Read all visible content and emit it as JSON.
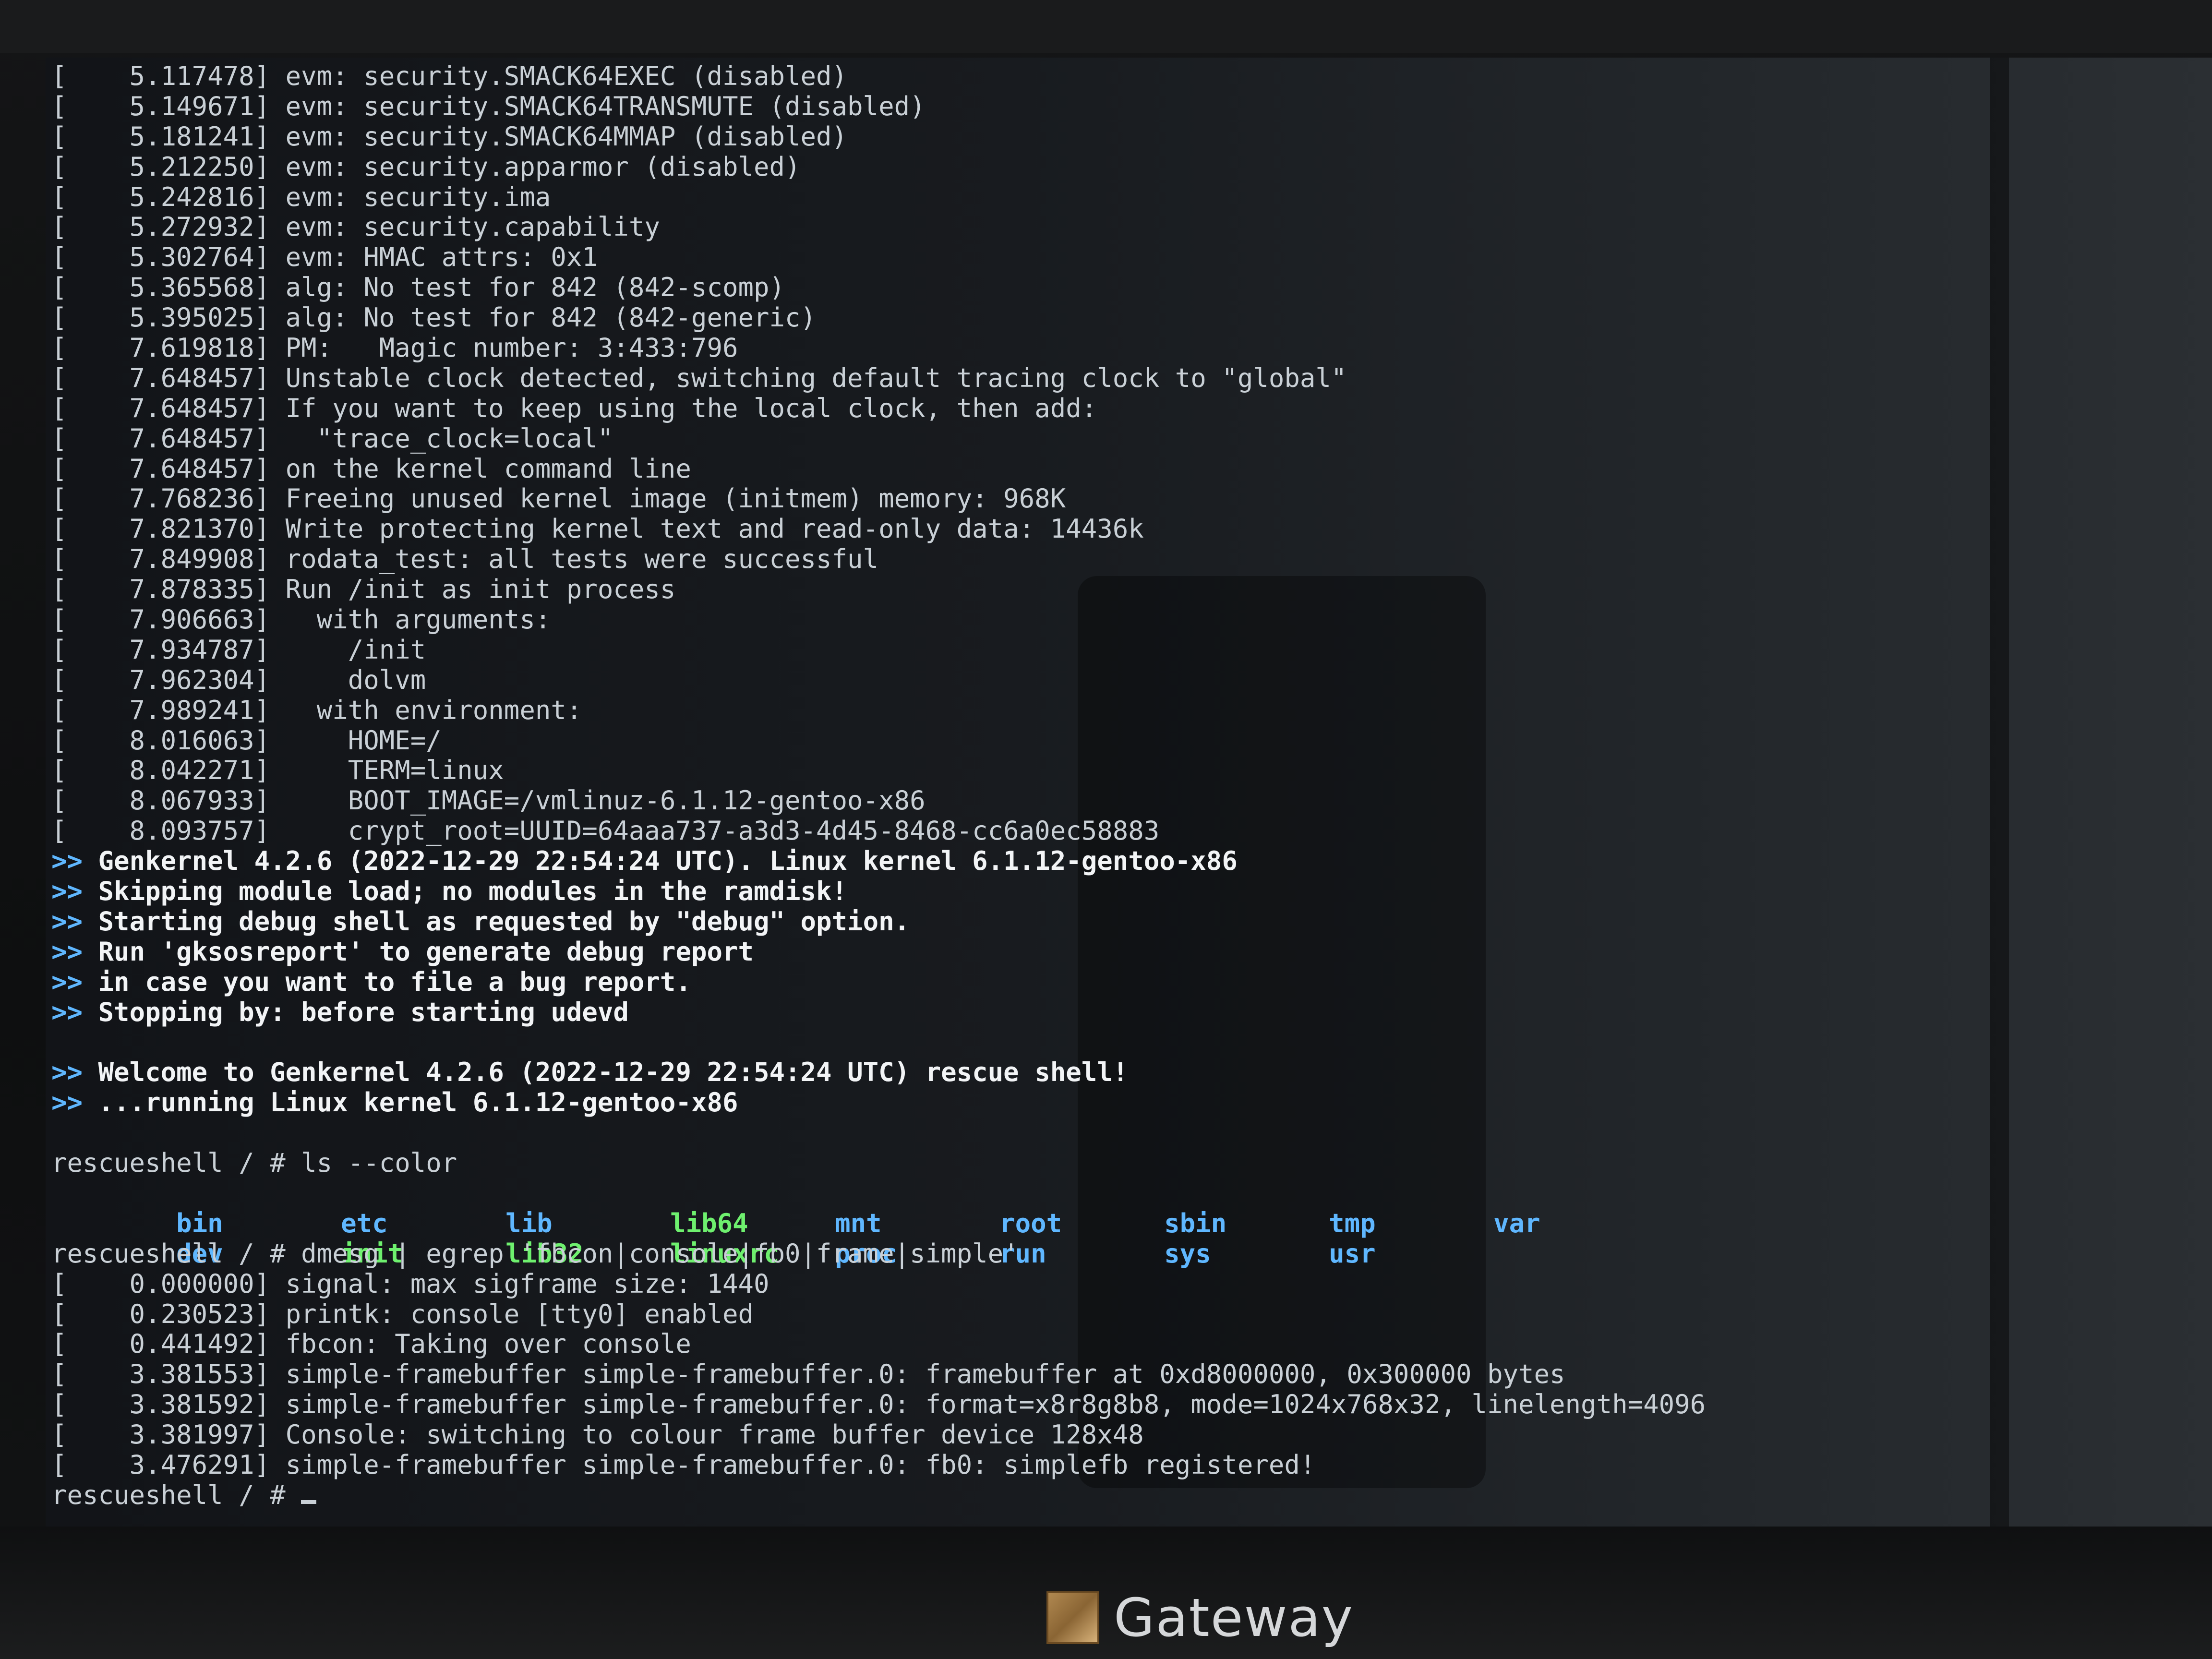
{
  "terminal": {
    "boot_log": [
      "[    5.117478] evm: security.SMACK64EXEC (disabled)",
      "[    5.149671] evm: security.SMACK64TRANSMUTE (disabled)",
      "[    5.181241] evm: security.SMACK64MMAP (disabled)",
      "[    5.212250] evm: security.apparmor (disabled)",
      "[    5.242816] evm: security.ima",
      "[    5.272932] evm: security.capability",
      "[    5.302764] evm: HMAC attrs: 0x1",
      "[    5.365568] alg: No test for 842 (842-scomp)",
      "[    5.395025] alg: No test for 842 (842-generic)",
      "[    7.619818] PM:   Magic number: 3:433:796",
      "[    7.648457] Unstable clock detected, switching default tracing clock to \"global\"",
      "[    7.648457] If you want to keep using the local clock, then add:",
      "[    7.648457]   \"trace_clock=local\"",
      "[    7.648457] on the kernel command line",
      "[    7.768236] Freeing unused kernel image (initmem) memory: 968K",
      "[    7.821370] Write protecting kernel text and read-only data: 14436k",
      "[    7.849908] rodata_test: all tests were successful",
      "[    7.878335] Run /init as init process",
      "[    7.906663]   with arguments:",
      "[    7.934787]     /init",
      "[    7.962304]     dolvm",
      "[    7.989241]   with environment:",
      "[    8.016063]     HOME=/",
      "[    8.042271]     TERM=linux",
      "[    8.067933]     BOOT_IMAGE=/vmlinuz-6.1.12-gentoo-x86",
      "[    8.093757]     crypt_root=UUID=64aaa737-a3d3-4d45-8468-cc6a0ec58883"
    ],
    "marker": ">>",
    "genkernel_msgs": [
      "Genkernel 4.2.6 (2022-12-29 22:54:24 UTC). Linux kernel 6.1.12-gentoo-x86",
      "Skipping module load; no modules in the ramdisk!",
      "Starting debug shell as requested by \"debug\" option.",
      "Run 'gksosreport' to generate debug report",
      "in case you want to file a bug report.",
      "Stopping by: before starting udevd"
    ],
    "welcome_msgs": [
      "Welcome to Genkernel 4.2.6 (2022-12-29 22:54:24 UTC) rescue shell!",
      "...running Linux kernel 6.1.12-gentoo-x86"
    ],
    "prompt_ls": "rescueshell / # ls --color",
    "ls_row1": [
      "bin",
      "etc",
      "lib",
      "lib64",
      "mnt",
      "root",
      "sbin",
      "tmp",
      "var"
    ],
    "ls_row2": [
      "dev",
      "init",
      "lib32",
      "linuxrc",
      "proc",
      "run",
      "sys",
      "usr"
    ],
    "prompt_dmesg": "rescueshell / # dmesg | egrep 'fbcon|console|fb0|frame|simple'",
    "dmesg_log": [
      "[    0.000000] signal: max sigframe size: 1440",
      "[    0.230523] printk: console [tty0] enabled",
      "[    0.441492] fbcon: Taking over console",
      "[    3.381553] simple-framebuffer simple-framebuffer.0: framebuffer at 0xd8000000, 0x300000 bytes",
      "[    3.381592] simple-framebuffer simple-framebuffer.0: format=x8r8g8b8, mode=1024x768x32, linelength=4096",
      "[    3.381997] Console: switching to colour frame buffer device 128x48",
      "[    3.476291] simple-framebuffer simple-framebuffer.0: fb0: simplefb registered!"
    ],
    "final_prompt": "rescueshell / # "
  },
  "monitor": {
    "brand": "Gateway"
  },
  "colors": {
    "text": "#c9d0d6",
    "marker": "#5fb7ff",
    "directory": "#5fb7ff",
    "executable": "#6ef06e"
  }
}
